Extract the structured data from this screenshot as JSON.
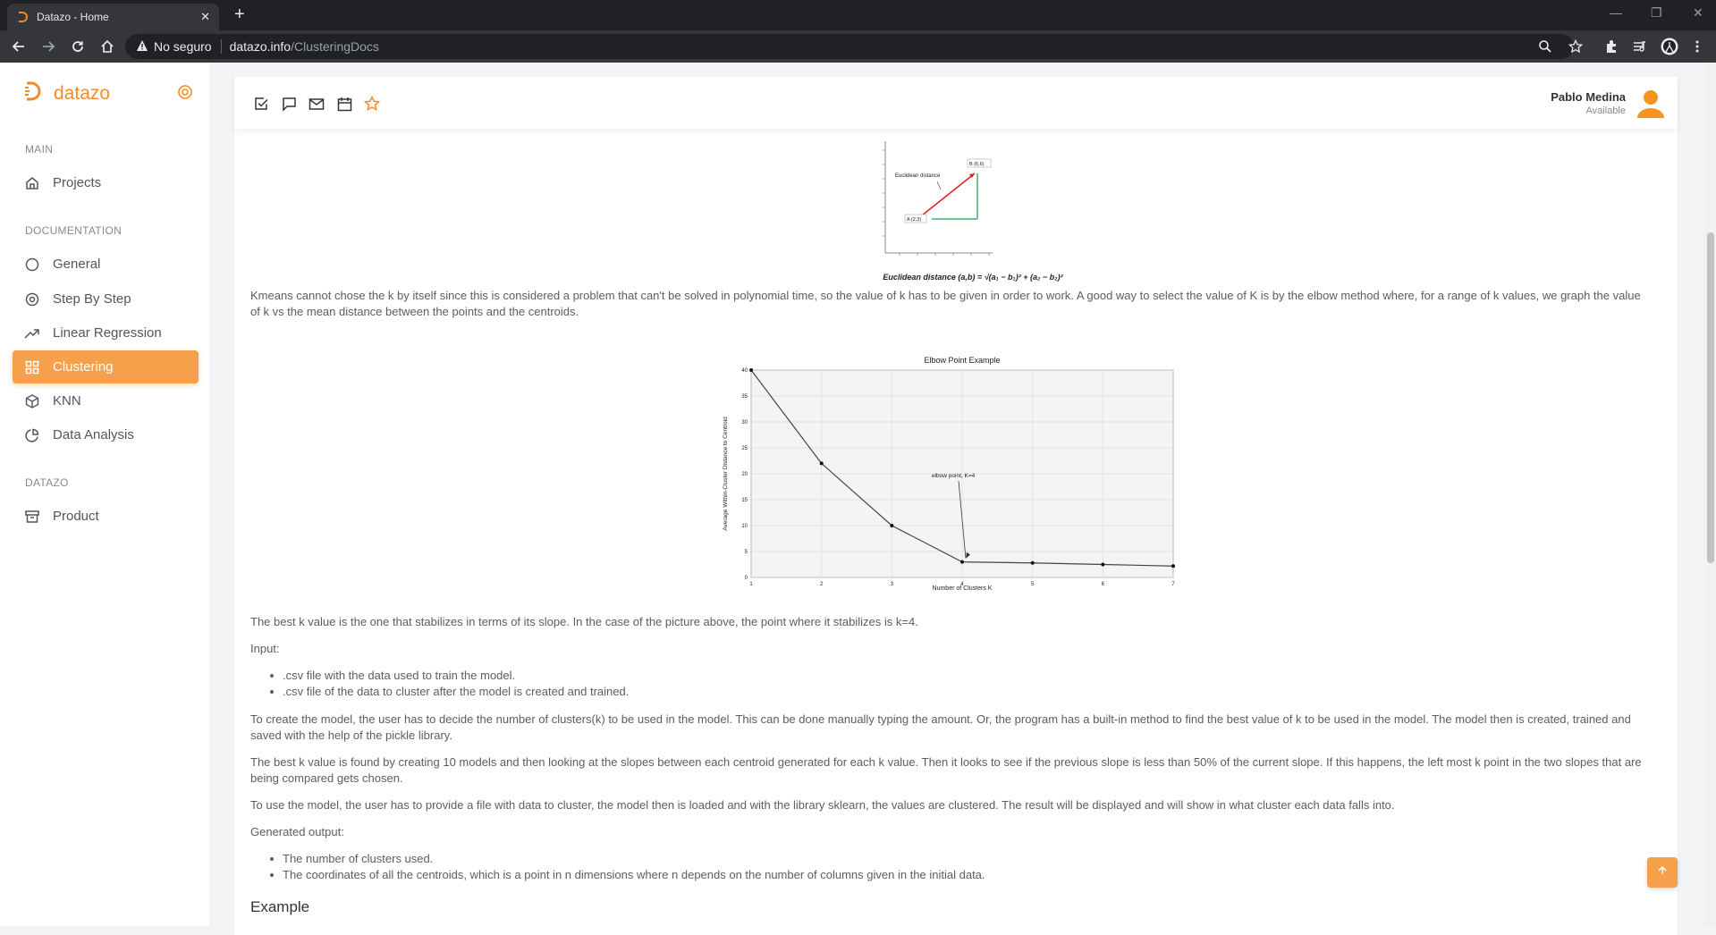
{
  "browser": {
    "tab_title": "Datazo - Home",
    "new_tab": "+",
    "security_label": "No seguro",
    "url_host": "datazo.info",
    "url_path": "/ClusteringDocs"
  },
  "sidebar": {
    "brand": "datazo",
    "sections": [
      {
        "title": "MAIN",
        "items": [
          {
            "label": "Projects",
            "icon": "home-icon"
          }
        ]
      },
      {
        "title": "DOCUMENTATION",
        "items": [
          {
            "label": "General",
            "icon": "circle-icon"
          },
          {
            "label": "Step By Step",
            "icon": "disc-icon"
          },
          {
            "label": "Linear Regression",
            "icon": "trending-up-icon"
          },
          {
            "label": "Clustering",
            "icon": "grid-icon",
            "active": true
          },
          {
            "label": "KNN",
            "icon": "box-icon"
          },
          {
            "label": "Data Analysis",
            "icon": "pie-chart-icon"
          }
        ]
      },
      {
        "title": "DATAZO",
        "items": [
          {
            "label": "Product",
            "icon": "archive-icon"
          }
        ]
      }
    ]
  },
  "topbar": {
    "tools": [
      "check-square-icon",
      "message-icon",
      "mail-icon",
      "calendar-icon",
      "star-icon"
    ],
    "user_name": "Pablo Medina",
    "user_status": "Available"
  },
  "euclid_figure": {
    "label": "Euclidean distance",
    "point_b": "B (6,6)",
    "point_a": "A (2,3)",
    "formula": "Euclidean distance (a,b) = √(a₁ − b₁)² + (a₂ − b₂)²"
  },
  "content": {
    "p1": "Kmeans cannot chose the k by itself since this is considered a problem that can't be solved in polynomial time, so the value of k has to be given in order to work. A good way to select the value of K is by the elbow method where, for a range of k values, we graph the value of k vs the mean distance between the points and the centroids.",
    "p2": "The best k value is the one that stabilizes in terms of its slope. In the case of the picture above, the point where it stabilizes is k=4.",
    "input_label": "Input:",
    "input_items": [
      ".csv file with the data used to train the model.",
      ".csv file of the data to cluster after the model is created and trained."
    ],
    "p3": "To create the model, the user has to decide the number of clusters(k) to be used in the model. This can be done manually typing the amount. Or, the program has a built-in method to find the best value of k to be used in the model. The model then is created, trained and saved with the help of the pickle library.",
    "p4": "The best k value is found by creating 10 models and then looking at the slopes between each centroid generated for each k value. Then it looks to see if the previous slope is less than 50% of the current slope. If this happens, the left most k point in the two slopes that are being compared gets chosen.",
    "p5": "To use the model, the user has to provide a file with data to cluster, the model then is loaded and with the library sklearn, the values are clustered. The result will be displayed and will show in what cluster each data falls into.",
    "output_label": "Generated output:",
    "output_items": [
      "The number of clusters used.",
      "The coordinates of all the centroids, which is a point in n dimensions where n depends on the number of columns given in the initial data."
    ],
    "example_heading": "Example"
  },
  "chart_data": {
    "type": "line",
    "title": "Elbow Point Example",
    "xlabel": "Number of Clusters K",
    "ylabel": "Average Within-Cluster Distance to Centroid",
    "x": [
      1,
      2,
      3,
      4,
      5,
      6,
      7
    ],
    "y": [
      40,
      22,
      10,
      3,
      2.8,
      2.5,
      2.2
    ],
    "xlim": [
      1,
      7
    ],
    "ylim": [
      0,
      40
    ],
    "yticks": [
      0,
      5,
      10,
      15,
      20,
      25,
      30,
      35,
      40
    ],
    "grid": true,
    "annotation": {
      "text": "elbow point, K=4",
      "x": 4,
      "y": 3
    }
  }
}
